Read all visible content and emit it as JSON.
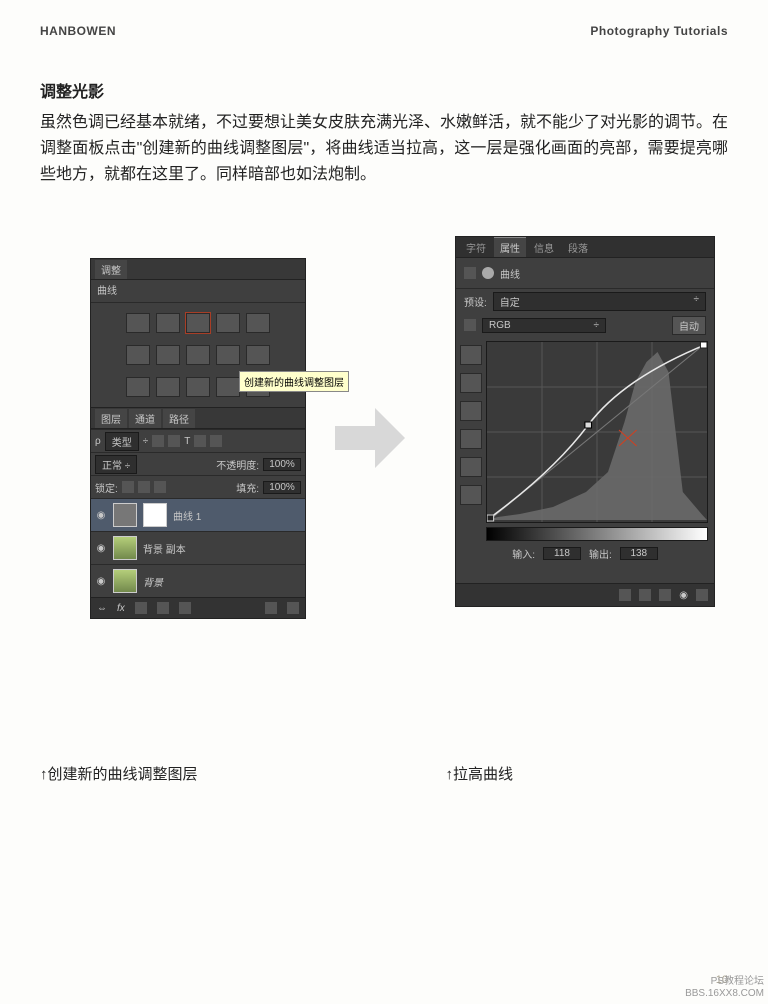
{
  "header": {
    "left": "HANBOWEN",
    "right": "Photography Tutorials"
  },
  "section_title": "调整光影",
  "body_text": "虽然色调已经基本就绪，不过要想让美女皮肤充满光泽、水嫩鲜活，就不能少了对光影的调节。在调整面板点击\"创建新的曲线调整图层\"，将曲线适当拉高，这一层是强化画面的亮部，需要提亮哪些地方，就都在这里了。同样暗部也如法炮制。",
  "captions": {
    "left": "↑创建新的曲线调整图层",
    "right": "↑拉高曲线"
  },
  "left_panel": {
    "tab_adjust": "调整",
    "subhead": "曲线",
    "tooltip": "创建新的曲线调整图层",
    "tabs2": {
      "layers": "图层",
      "channels": "通道",
      "paths": "路径"
    },
    "type_label": "类型",
    "blend_label": "正常",
    "opacity_label": "不透明度:",
    "opacity_value": "100%",
    "lock_label": "锁定:",
    "fill_label": "填充:",
    "fill_value": "100%",
    "layer1": "曲线 1",
    "layer2": "背景 副本",
    "layer3": "背景"
  },
  "right_panel": {
    "tabs": {
      "char": "字符",
      "prop": "属性",
      "info": "信息",
      "para": "段落"
    },
    "title": "曲线",
    "preset_label": "预设:",
    "preset_value": "自定",
    "channel_value": "RGB",
    "auto_btn": "自动",
    "input_label": "输入:",
    "input_value": "118",
    "output_label": "输出:",
    "output_value": "138"
  },
  "footer": {
    "page": "10",
    "wm1": "PS教程论坛",
    "wm2": "BBS.16XX8.COM"
  }
}
